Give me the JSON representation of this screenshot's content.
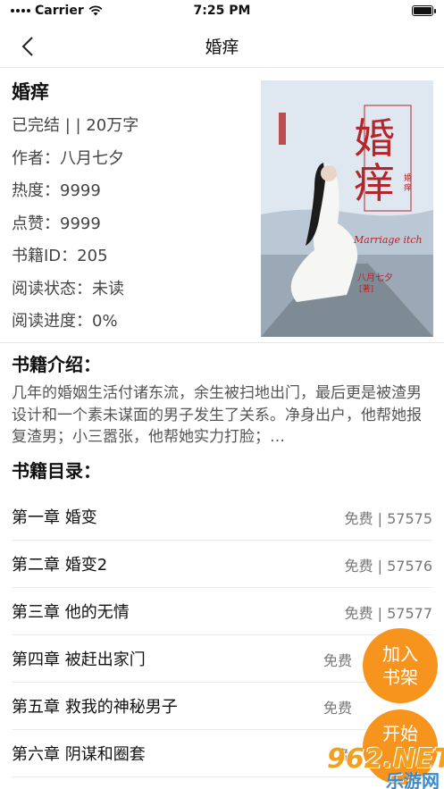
{
  "status_bar": {
    "carrier": "Carrier",
    "time": "7:25 PM"
  },
  "nav": {
    "title": "婚痒"
  },
  "book": {
    "title": "婚痒",
    "status_line": "已完结 | | 20万字",
    "author": "作者：八月七夕",
    "heat": "热度：9999",
    "likes": "点赞：9999",
    "book_id": "书籍ID：205",
    "read_status": "阅读状态：未读",
    "read_progress": "阅读进度：0%",
    "cover": {
      "title_big": "婚痒",
      "title_small": "婚痒",
      "english": "Marriage itch",
      "author": "八月七夕",
      "author_tag": "[著]"
    }
  },
  "intro": {
    "heading": "书籍介绍：",
    "text": "几年的婚姻生活付诸东流，余生被扫地出门，最后更是被渣男设计和一个素未谋面的男子发生了关系。净身出户，他帮她报复渣男；小三嚣张，他帮她实力打脸；…"
  },
  "catalog": {
    "heading": "书籍目录：",
    "chapters": [
      {
        "name": "第一章 婚变",
        "info": "免费 | 57575"
      },
      {
        "name": "第二章 婚变2",
        "info": "免费 | 57576"
      },
      {
        "name": "第三章 他的无情",
        "info": "免费 | 57577"
      },
      {
        "name": "第四章 被赶出家门",
        "info": "免费"
      },
      {
        "name": "第五章 救我的神秘男子",
        "info": "免费"
      },
      {
        "name": "第六章 阴谋和圈套",
        "info": "免"
      }
    ]
  },
  "actions": {
    "add_shelf": "加入书架",
    "start_read": "开始"
  },
  "watermark": {
    "text": "962.NET",
    "sub": "乐游网"
  },
  "colors": {
    "accent": "#f7941e",
    "cover_red": "#b3262b"
  }
}
